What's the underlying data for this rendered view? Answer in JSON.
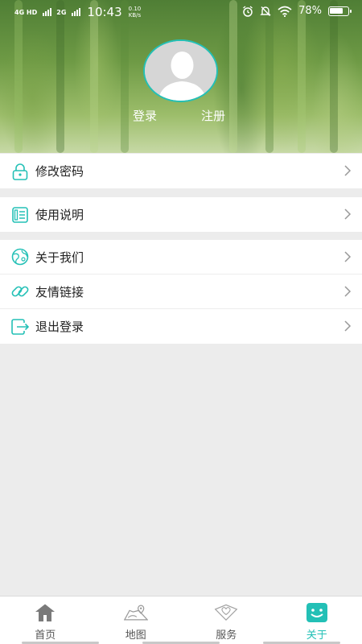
{
  "status_bar": {
    "network_1": "4G HD",
    "network_2": "2G",
    "time": "10:43",
    "speed_value": "0.10",
    "speed_unit": "KB/s",
    "icons": [
      "alarm-icon",
      "mute-icon",
      "wifi-icon"
    ],
    "battery_percent": "78%",
    "battery_level": 0.78
  },
  "profile": {
    "login_label": "登录",
    "register_label": "注册",
    "accent_color": "#23c0b6"
  },
  "menu": {
    "groups": [
      [
        {
          "label": "修改密码",
          "icon": "lock-icon"
        }
      ],
      [
        {
          "label": "使用说明",
          "icon": "document-icon"
        }
      ],
      [
        {
          "label": "关于我们",
          "icon": "globe-icon"
        },
        {
          "label": "友情链接",
          "icon": "link-icon"
        },
        {
          "label": "退出登录",
          "icon": "logout-icon"
        }
      ]
    ]
  },
  "tabbar": {
    "tabs": [
      {
        "label": "首页",
        "icon": "home-icon",
        "active": false
      },
      {
        "label": "地图",
        "icon": "map-icon",
        "active": false
      },
      {
        "label": "服务",
        "icon": "service-icon",
        "active": false
      },
      {
        "label": "关于",
        "icon": "about-icon",
        "active": true
      }
    ]
  }
}
